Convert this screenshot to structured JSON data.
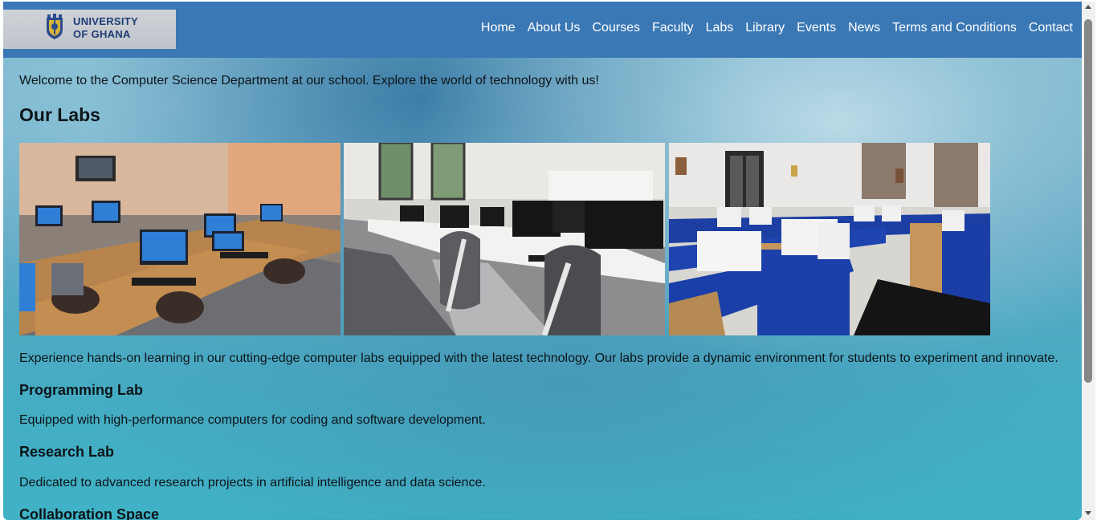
{
  "brand": {
    "line1": "UNIVERSITY",
    "line2": "OF GHANA",
    "icon": "university-crest-icon"
  },
  "nav": {
    "items": [
      {
        "label": "Home"
      },
      {
        "label": "About Us"
      },
      {
        "label": "Courses"
      },
      {
        "label": "Faculty"
      },
      {
        "label": "Labs"
      },
      {
        "label": "Library"
      },
      {
        "label": "Events"
      },
      {
        "label": "News"
      },
      {
        "label": "Terms and Conditions"
      },
      {
        "label": "Contact"
      }
    ]
  },
  "main": {
    "welcome": "Welcome to the Computer Science Department at our school. Explore the world of technology with us!",
    "section_title": "Our Labs",
    "intro": "Experience hands-on learning in our cutting-edge computer labs equipped with the latest technology. Our labs provide a dynamic environment for students to experiment and innovate.",
    "labs": [
      {
        "title": "Programming Lab",
        "description": "Equipped with high-performance computers for coding and software development."
      },
      {
        "title": "Research Lab",
        "description": "Dedicated to advanced research projects in artificial intelligence and data science."
      },
      {
        "title": "Collaboration Space",
        "description": ""
      }
    ]
  },
  "colors": {
    "navbar": "#3a78b5",
    "nav_text": "#ffffff",
    "logo_text": "#1f3b75",
    "body_text": "#0d1418",
    "page_background": "#45acc3"
  }
}
